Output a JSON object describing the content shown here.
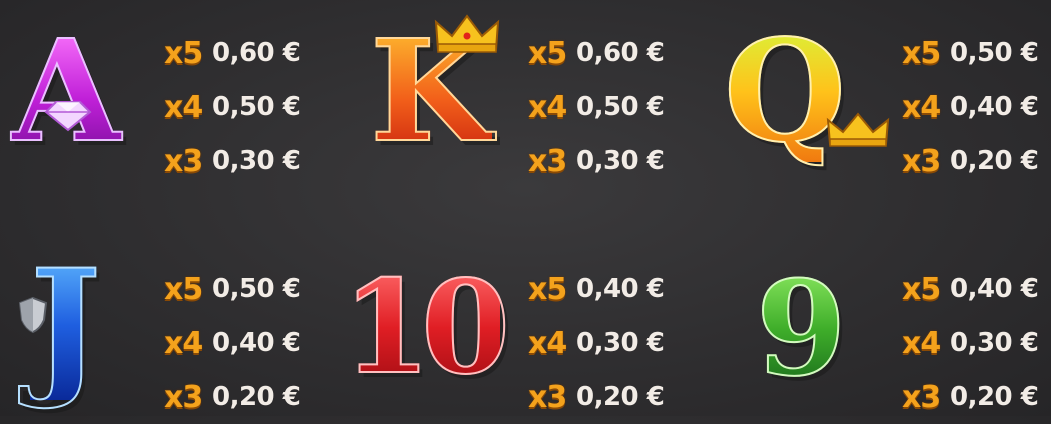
{
  "symbols": [
    {
      "name": "A",
      "color_top": "#ff66ff",
      "color_bottom": "#9a14b8",
      "outline": "#d9a8ff",
      "rows": [
        {
          "mult": "x5",
          "value": "0,60 €"
        },
        {
          "mult": "x4",
          "value": "0,50 €"
        },
        {
          "mult": "x3",
          "value": "0,30 €"
        }
      ]
    },
    {
      "name": "K",
      "color_top": "#ffb020",
      "color_bottom": "#d8300e",
      "outline": "#ffd38a",
      "rows": [
        {
          "mult": "x5",
          "value": "0,60 €"
        },
        {
          "mult": "x4",
          "value": "0,50 €"
        },
        {
          "mult": "x3",
          "value": "0,30 €"
        }
      ]
    },
    {
      "name": "Q",
      "color_top": "#c9f22a",
      "color_bottom": "#f08a10",
      "outline": "#ffe7a0",
      "rows": [
        {
          "mult": "x5",
          "value": "0,50 €"
        },
        {
          "mult": "x4",
          "value": "0,40 €"
        },
        {
          "mult": "x3",
          "value": "0,20 €"
        }
      ]
    },
    {
      "name": "J",
      "color_top": "#44a8ff",
      "color_bottom": "#0a2fb0",
      "outline": "#9fd4ff",
      "rows": [
        {
          "mult": "x5",
          "value": "0,50 €"
        },
        {
          "mult": "x4",
          "value": "0,40 €"
        },
        {
          "mult": "x3",
          "value": "0,20 €"
        }
      ]
    },
    {
      "name": "10",
      "color_top": "#ff5050",
      "color_bottom": "#b00c12",
      "outline": "#ffb0b0",
      "rows": [
        {
          "mult": "x5",
          "value": "0,40 €"
        },
        {
          "mult": "x4",
          "value": "0,30 €"
        },
        {
          "mult": "x3",
          "value": "0,20 €"
        }
      ]
    },
    {
      "name": "9",
      "color_top": "#7ee05a",
      "color_bottom": "#1e7a1a",
      "outline": "#c8f7b0",
      "rows": [
        {
          "mult": "x5",
          "value": "0,40 €"
        },
        {
          "mult": "x4",
          "value": "0,30 €"
        },
        {
          "mult": "x3",
          "value": "0,20 €"
        }
      ]
    }
  ],
  "accent_multiplier_color": "#f4a21c",
  "value_text_color": "#f2ece6"
}
